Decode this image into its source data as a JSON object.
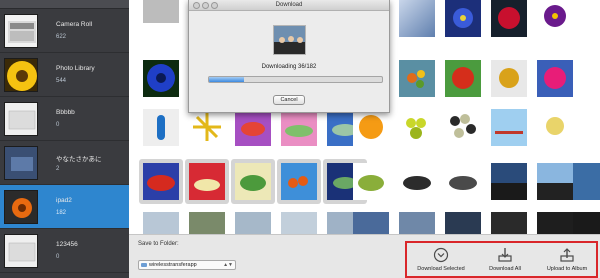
{
  "dialog": {
    "title": "Download",
    "status_text": "Downloading 36/182",
    "progress": 0.2,
    "cancel_label": "Cancel"
  },
  "albums": [
    {
      "name": "Camera Roll",
      "count": "622"
    },
    {
      "name": "Photo Library",
      "count": "544"
    },
    {
      "name": "Bbbbb",
      "count": "0"
    },
    {
      "name": "やなたさかあに",
      "count": "2"
    },
    {
      "name": "ipad2",
      "count": "182",
      "selected": true
    },
    {
      "name": "123456",
      "count": "0"
    }
  ],
  "bottom_bar": {
    "save_folder_label": "Save to Folder:",
    "folder_value": "wirelesstransferapp",
    "download_selected_label": "Download Selected",
    "download_all_label": "Download All",
    "upload_label": "Upload to Album"
  },
  "colors": {
    "sidebar_bg": "#3a3b3f",
    "selection_blue": "#2e86cf",
    "highlight_red": "#d9262a",
    "progress_blue": "#3d8ae0"
  }
}
